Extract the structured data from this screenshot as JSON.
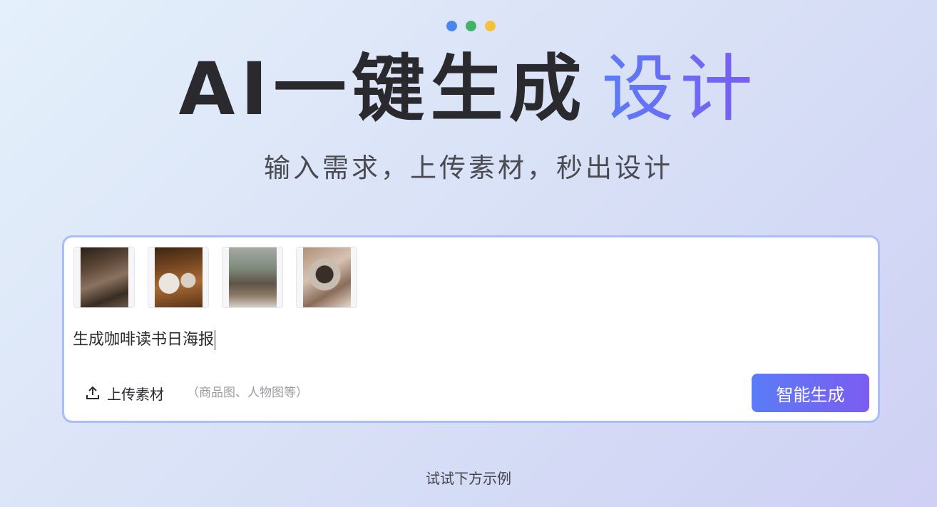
{
  "header": {
    "title_main": "AI一键生成",
    "title_accent": "设计",
    "subtitle": "输入需求，上传素材，秒出设计"
  },
  "composer": {
    "thumbnails": [
      {
        "icon": "coffee-books-photo"
      },
      {
        "icon": "coffee-latte-photo"
      },
      {
        "icon": "window-reading-photo"
      },
      {
        "icon": "coffee-cup-photo"
      }
    ],
    "prompt_text": "生成咖啡读书日海报",
    "upload_label": "上传素材",
    "upload_hint": "（商品图、人物图等）",
    "upload_icon": "upload-icon",
    "generate_label": "智能生成"
  },
  "footer": {
    "examples_label": "试试下方示例"
  },
  "colors": {
    "accent_start": "#5b7cf6",
    "accent_end": "#7c5cf1",
    "dot_blue": "#4a86f0",
    "dot_green": "#3fb36a",
    "dot_yellow": "#f6c13a",
    "composer_border": "#a9bcfb"
  }
}
